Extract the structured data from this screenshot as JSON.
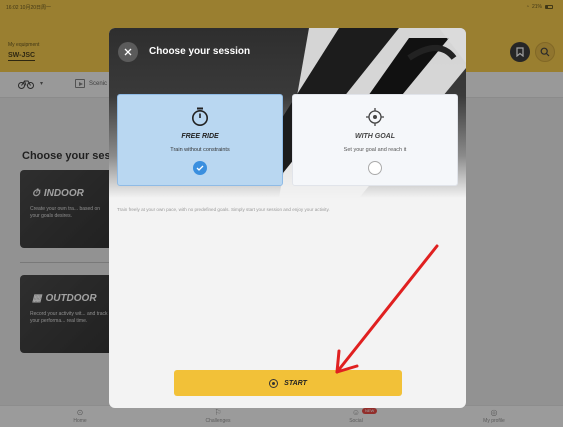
{
  "status_bar": {
    "time": "16:02  10月20日周一",
    "battery": "21%"
  },
  "header": {
    "equipment_label": "My equipment",
    "equipment_name": "SW-JSC"
  },
  "subbar": {
    "bike_icon": "bike-icon",
    "scenario_label": "Scenic"
  },
  "background": {
    "section_title": "Choose your sessi",
    "indoor": {
      "title": "INDOOR",
      "description": "Create your own tra... based on your goals desires."
    },
    "outdoor": {
      "title": "OUTDOOR",
      "description": "Record your activity wit... and track your performa... real time."
    }
  },
  "modal": {
    "title": "Choose your session",
    "options": [
      {
        "title": "FREE RIDE",
        "description": "Train without constraints",
        "selected": true,
        "icon": "stopwatch-icon"
      },
      {
        "title": "WITH GOAL",
        "description": "Set your goal and reach it",
        "selected": false,
        "icon": "target-icon"
      }
    ],
    "description": "Train freely at your own pace, with no predefined goals. Simply start your session and enjoy your activity.",
    "start_label": "START"
  },
  "tab_bar": {
    "items": [
      {
        "label": "Home",
        "icon": "home-icon"
      },
      {
        "label": "Challenges",
        "icon": "flag-icon"
      },
      {
        "label": "Social",
        "icon": "social-icon",
        "badge": "NEW"
      },
      {
        "label": "My profile",
        "icon": "profile-icon"
      }
    ]
  },
  "colors": {
    "brand_yellow": "#f2c138",
    "selected_blue": "#b9d7f1",
    "check_blue": "#3a8fdf",
    "annotation_red": "#e02020"
  }
}
